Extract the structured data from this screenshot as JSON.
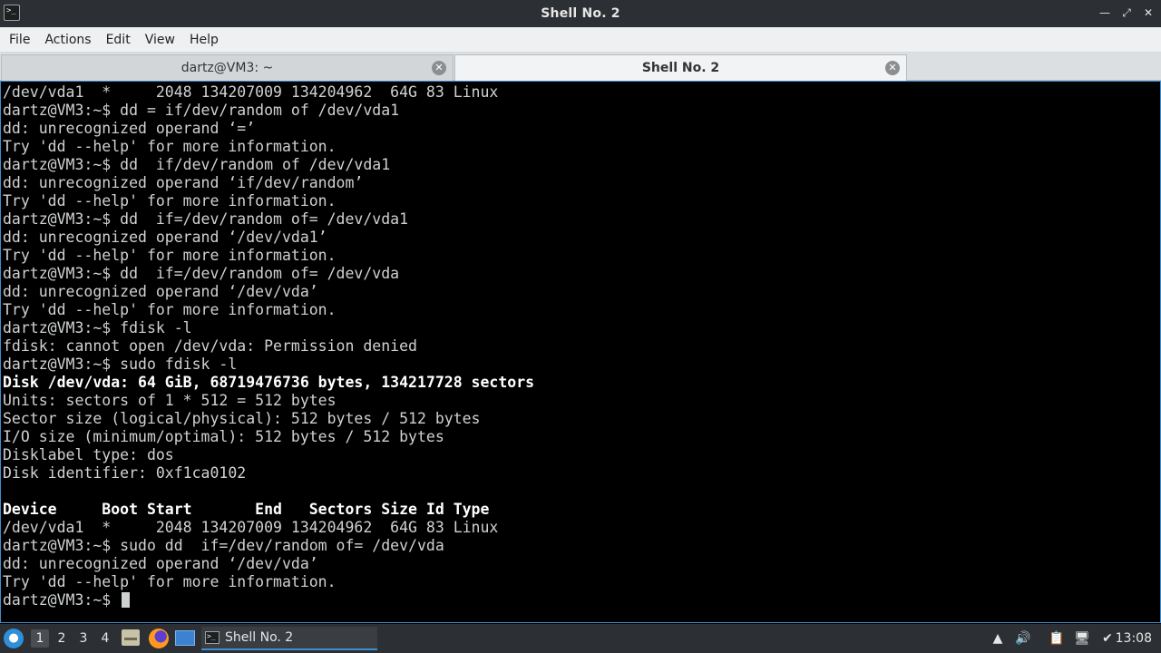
{
  "window": {
    "title": "Shell No. 2"
  },
  "menu": [
    "File",
    "Actions",
    "Edit",
    "View",
    "Help"
  ],
  "tabs": [
    {
      "label": "dartz@VM3: ~",
      "active": false
    },
    {
      "label": "Shell No. 2",
      "active": true
    }
  ],
  "terminal": {
    "lines": [
      {
        "text": "/dev/vda1  *     2048 134207009 134204962  64G 83 Linux",
        "bold": false
      },
      {
        "text": "dartz@VM3:~$ dd = if/dev/random of /dev/vda1",
        "bold": false
      },
      {
        "text": "dd: unrecognized operand ‘=’",
        "bold": false
      },
      {
        "text": "Try 'dd --help' for more information.",
        "bold": false
      },
      {
        "text": "dartz@VM3:~$ dd  if/dev/random of /dev/vda1",
        "bold": false
      },
      {
        "text": "dd: unrecognized operand ‘if/dev/random’",
        "bold": false
      },
      {
        "text": "Try 'dd --help' for more information.",
        "bold": false
      },
      {
        "text": "dartz@VM3:~$ dd  if=/dev/random of= /dev/vda1",
        "bold": false
      },
      {
        "text": "dd: unrecognized operand ‘/dev/vda1’",
        "bold": false
      },
      {
        "text": "Try 'dd --help' for more information.",
        "bold": false
      },
      {
        "text": "dartz@VM3:~$ dd  if=/dev/random of= /dev/vda",
        "bold": false
      },
      {
        "text": "dd: unrecognized operand ‘/dev/vda’",
        "bold": false
      },
      {
        "text": "Try 'dd --help' for more information.",
        "bold": false
      },
      {
        "text": "dartz@VM3:~$ fdisk -l",
        "bold": false
      },
      {
        "text": "fdisk: cannot open /dev/vda: Permission denied",
        "bold": false
      },
      {
        "text": "dartz@VM3:~$ sudo fdisk -l",
        "bold": false
      },
      {
        "text": "Disk /dev/vda: 64 GiB, 68719476736 bytes, 134217728 sectors",
        "bold": true
      },
      {
        "text": "Units: sectors of 1 * 512 = 512 bytes",
        "bold": false
      },
      {
        "text": "Sector size (logical/physical): 512 bytes / 512 bytes",
        "bold": false
      },
      {
        "text": "I/O size (minimum/optimal): 512 bytes / 512 bytes",
        "bold": false
      },
      {
        "text": "Disklabel type: dos",
        "bold": false
      },
      {
        "text": "Disk identifier: 0xf1ca0102",
        "bold": false
      },
      {
        "text": "",
        "bold": false
      },
      {
        "text": "Device     Boot Start       End   Sectors Size Id Type",
        "bold": true
      },
      {
        "text": "/dev/vda1  *     2048 134207009 134204962  64G 83 Linux",
        "bold": false
      },
      {
        "text": "dartz@VM3:~$ sudo dd  if=/dev/random of= /dev/vda",
        "bold": false
      },
      {
        "text": "dd: unrecognized operand ‘/dev/vda’",
        "bold": false
      },
      {
        "text": "Try 'dd --help' for more information.",
        "bold": false
      }
    ],
    "prompt": "dartz@VM3:~$ "
  },
  "taskbar": {
    "desktops": [
      "1",
      "2",
      "3",
      "4"
    ],
    "current_desktop": "1",
    "task_label": "Shell No. 2",
    "clock": "13:08"
  },
  "icons": {
    "start": "start-menu-icon",
    "files": "file-manager-icon",
    "browser": "firefox-icon",
    "desktop": "show-desktop-icon",
    "terminal": "terminal-icon",
    "tray": [
      "tray-arrow-icon",
      "volume-icon",
      "clipboard-icon",
      "network-icon",
      "update-icon"
    ]
  }
}
